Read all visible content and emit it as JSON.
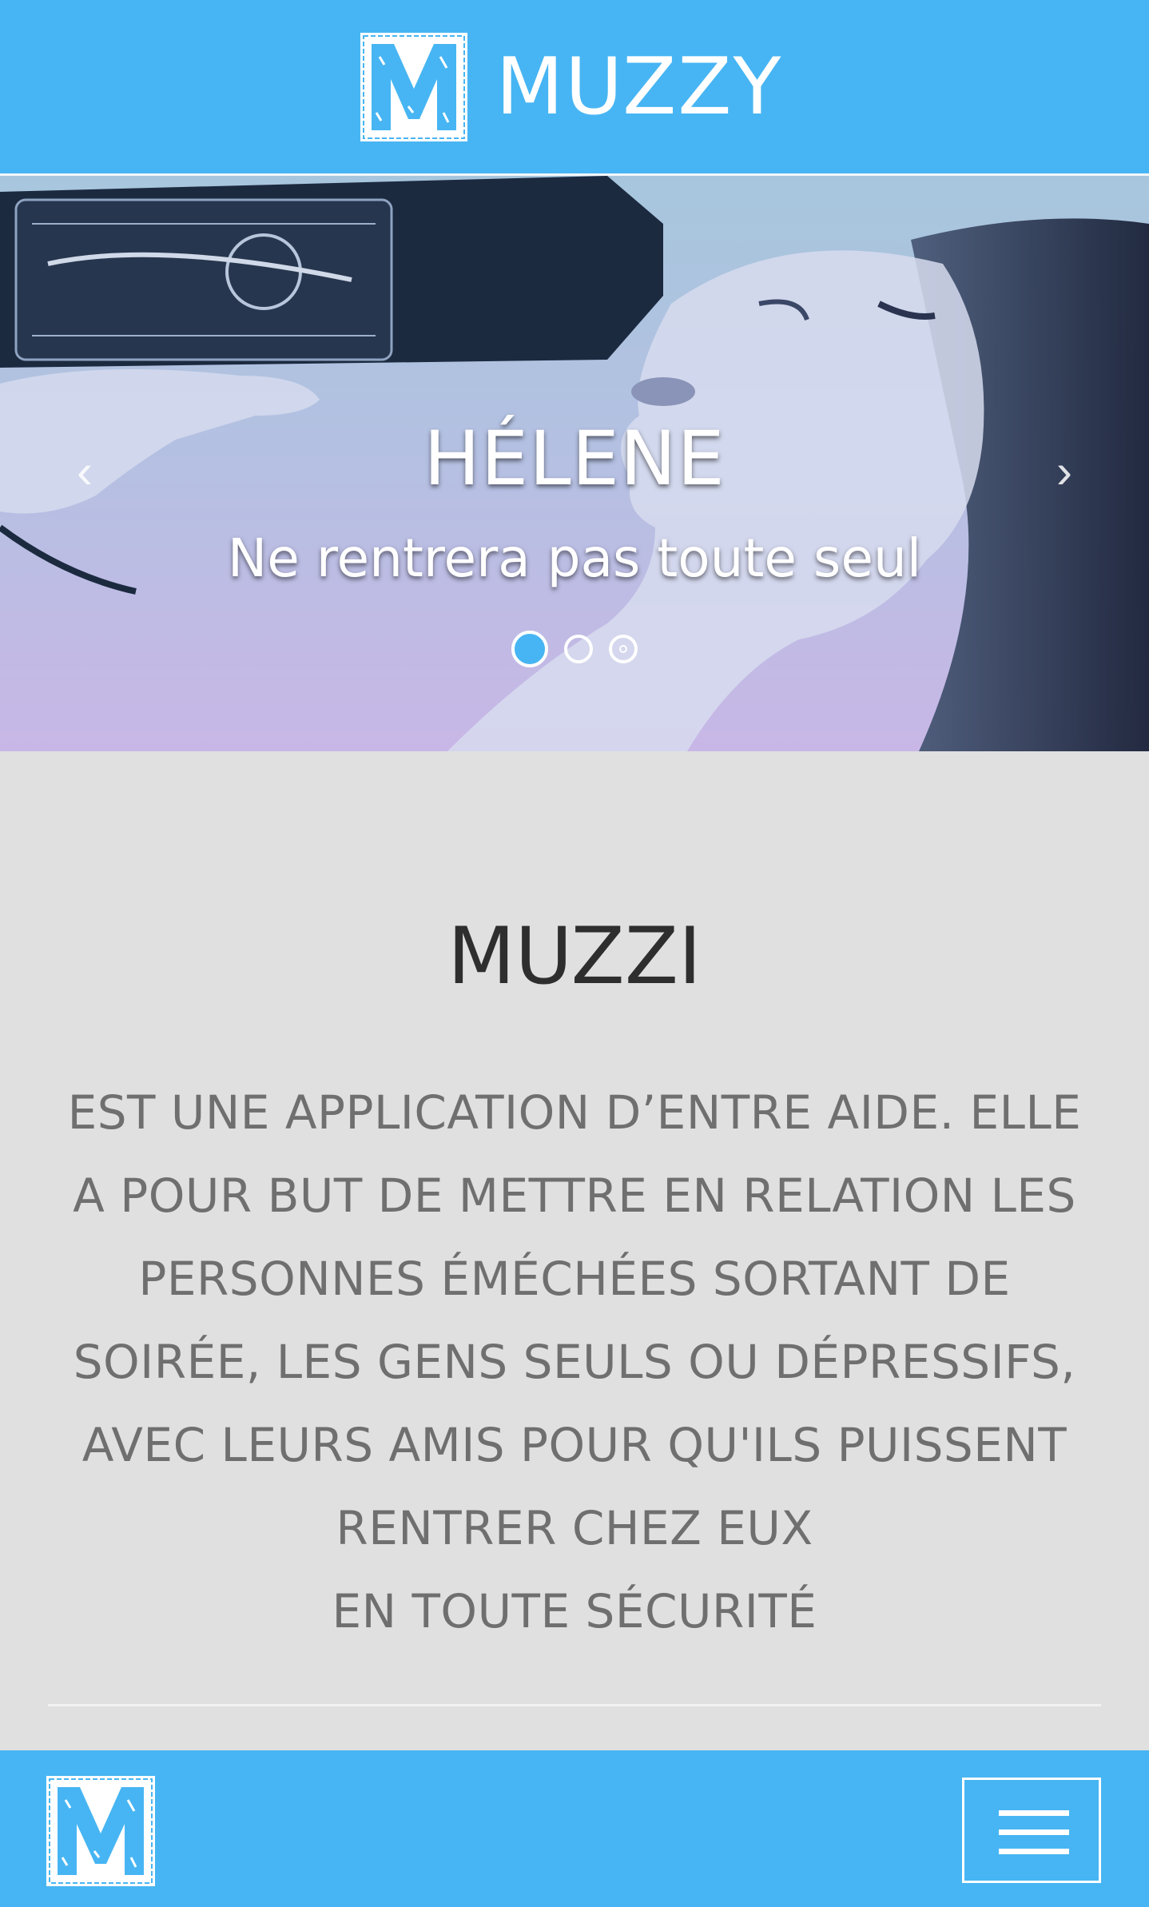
{
  "header": {
    "brand_name": "MUZZY",
    "logo_letter": "M"
  },
  "carousel": {
    "title": "HÉLENE",
    "subtitle": "Ne rentrera pas toute seul",
    "prev_label": "‹",
    "next_label": "›",
    "slide_count": 3,
    "active_slide": 1
  },
  "content": {
    "title": "MUZZI",
    "description_lines": [
      "EST UNE APPLICATION D’ENTRE AIDE. ELLE",
      "A POUR BUT DE METTRE EN RELATION LES",
      "PERSONNES ÉMÉCHÉES SORTANT DE",
      "SOIRÉE, LES GENS SEULS OU DÉPRESSIFS,",
      "AVEC LEURS AMIS POUR QU'ILS PUISSENT",
      "RENTRER CHEZ EUX",
      "EN TOUTE SÉCURITÉ"
    ]
  },
  "bottom_nav": {
    "logo_letter": "M",
    "menu_icon": "hamburger-icon"
  },
  "colors": {
    "accent": "#47b5f3",
    "content_bg": "#e0e0e0",
    "title_text": "#2e2e2e",
    "body_text": "#6f6f6f"
  }
}
